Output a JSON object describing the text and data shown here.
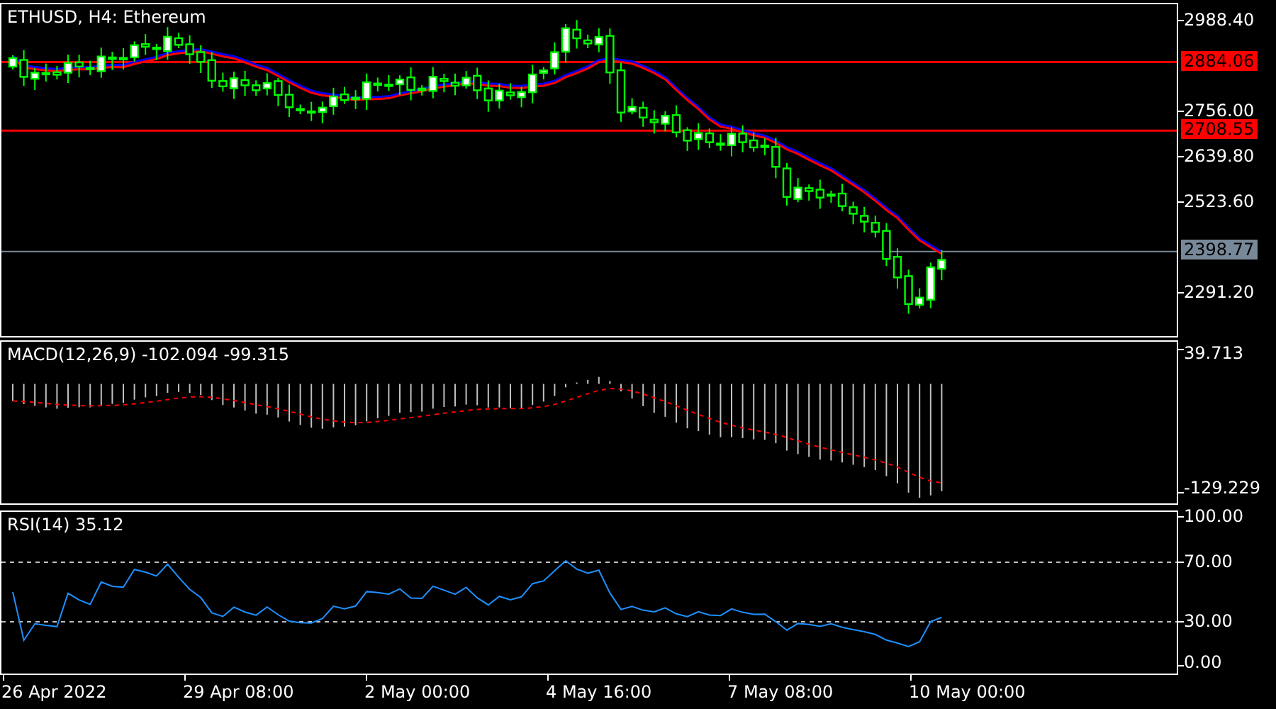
{
  "chart": {
    "title": "ETHUSD, H4:  Ethereum",
    "price_labels": [
      "2988.40",
      "2756.00",
      "2639.80",
      "2523.60",
      "2291.20"
    ],
    "level_lines": [
      {
        "label": "2884.06",
        "color": "#ff0000"
      },
      {
        "label": "2708.55",
        "color": "#ff0000"
      }
    ],
    "current_price": {
      "label": "2398.77"
    }
  },
  "macd": {
    "title": "MACD(12,26,9) -102.094 -99.315",
    "scale_labels": [
      "39.713",
      "-129.229"
    ]
  },
  "rsi": {
    "title": "RSI(14) 35.12",
    "scale_labels": [
      "100.00",
      "70.00",
      "30.00",
      "0.00"
    ]
  },
  "time_axis": [
    "26 Apr 2022",
    "29 Apr 08:00",
    "2 May 00:00",
    "4 May 16:00",
    "7 May 08:00",
    "10 May 00:00"
  ]
}
